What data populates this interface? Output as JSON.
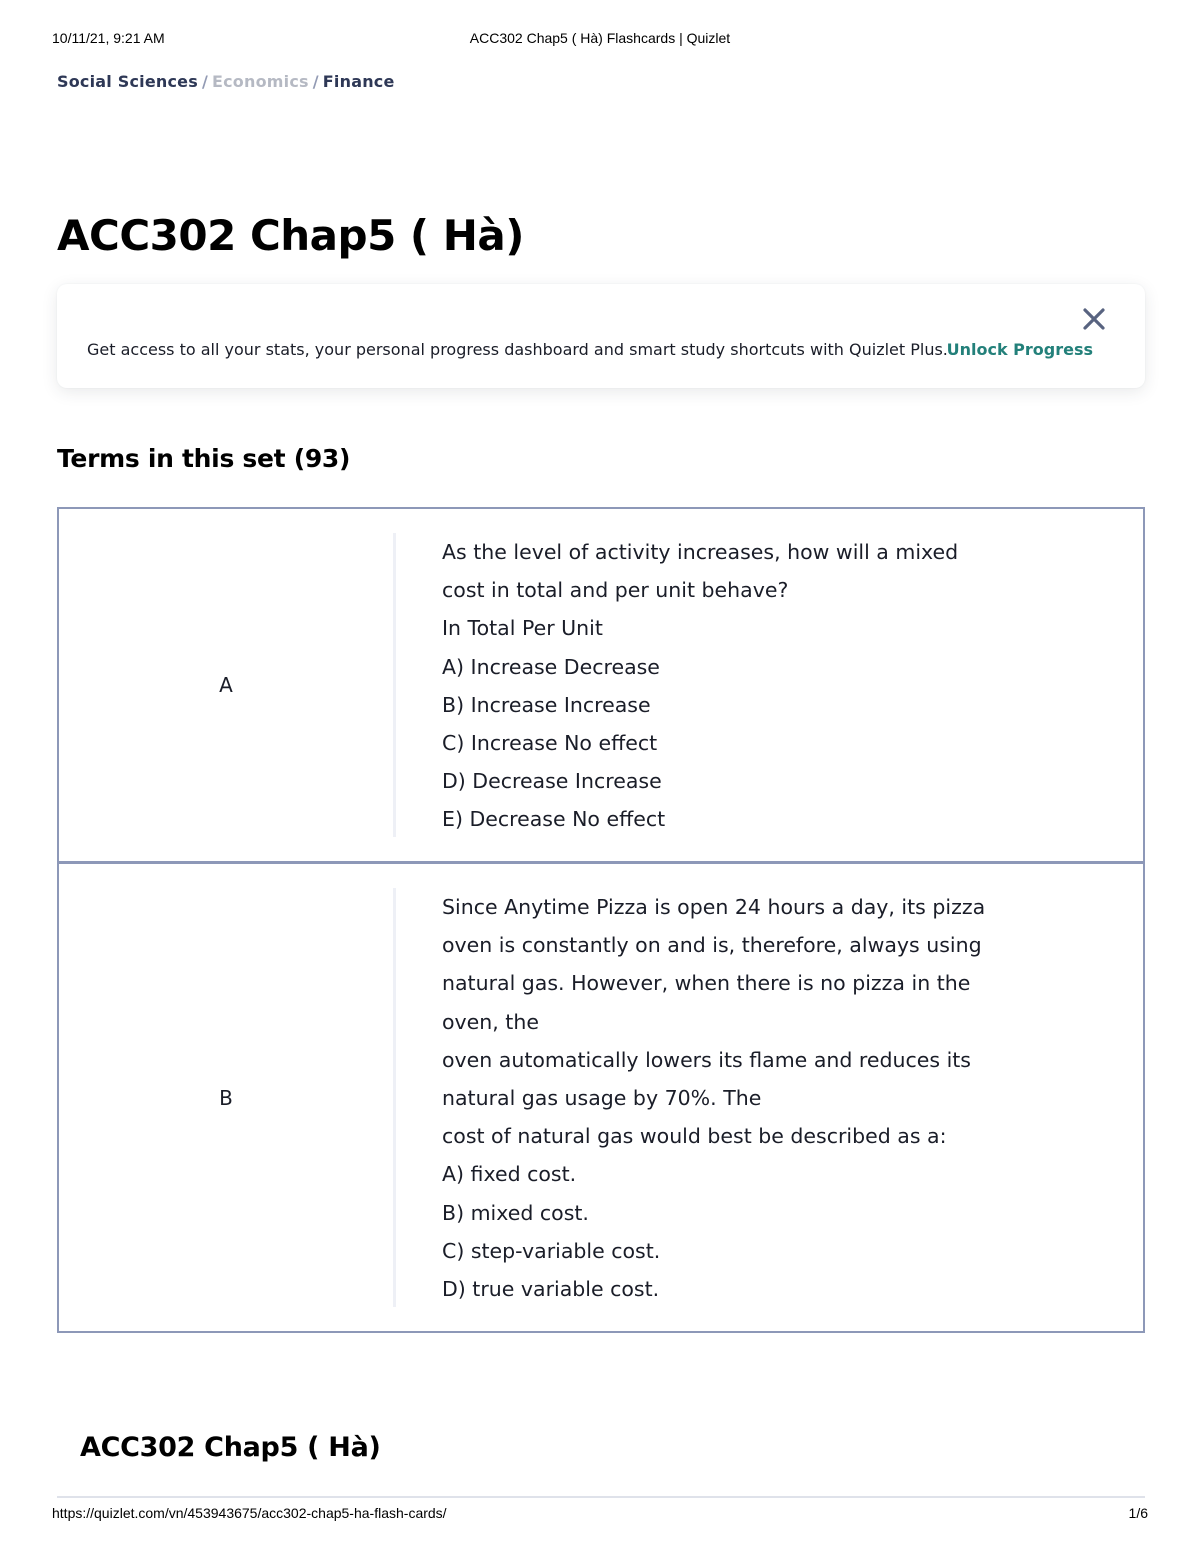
{
  "print_header": {
    "date": "10/11/21, 9:21 AM",
    "title": "ACC302 Chap5 ( Hà) Flashcards | Quizlet"
  },
  "breadcrumb": [
    {
      "label": "Social Sciences",
      "faded": false
    },
    {
      "label": "Economics",
      "faded": true
    },
    {
      "label": "Finance",
      "faded": false
    }
  ],
  "set": {
    "title": "ACC302 Chap5 ( Hà)"
  },
  "banner": {
    "text": "Get access to all your stats, your personal progress dashboard and smart study shortcuts with Quizlet Plus.",
    "link_label": "Unlock Progress",
    "close_icon": "close-icon",
    "link_color": "#23807a",
    "close_color": "#586380"
  },
  "terms_section": {
    "heading": "Terms in this set (93)",
    "border_color": "#8d98b8",
    "terms": [
      {
        "term": "A",
        "definition": [
          "As the level of activity increases, how will a mixed",
          "cost in total and per unit behave?",
          "In Total Per Unit",
          "A) Increase Decrease",
          "B) Increase Increase",
          "C) Increase No effect",
          "D) Decrease Increase",
          "E) Decrease No effect"
        ]
      },
      {
        "term": "B",
        "definition": [
          "Since Anytime Pizza is open 24 hours a day, its pizza",
          "oven is constantly on and is, therefore, always using",
          "natural gas. However, when there is no pizza in the",
          "oven, the",
          "oven automatically lowers its flame and reduces its",
          "natural gas usage by 70%. The",
          "cost of natural gas would best be described as a:",
          "A) fixed cost.",
          "B) mixed cost.",
          "C) step-variable cost.",
          "D) true variable cost."
        ]
      }
    ]
  },
  "footer": {
    "set_title": "ACC302 Chap5 ( Hà)",
    "url": "https://quizlet.com/vn/453943675/acc302-chap5-ha-flash-cards/",
    "page": "1/6"
  }
}
